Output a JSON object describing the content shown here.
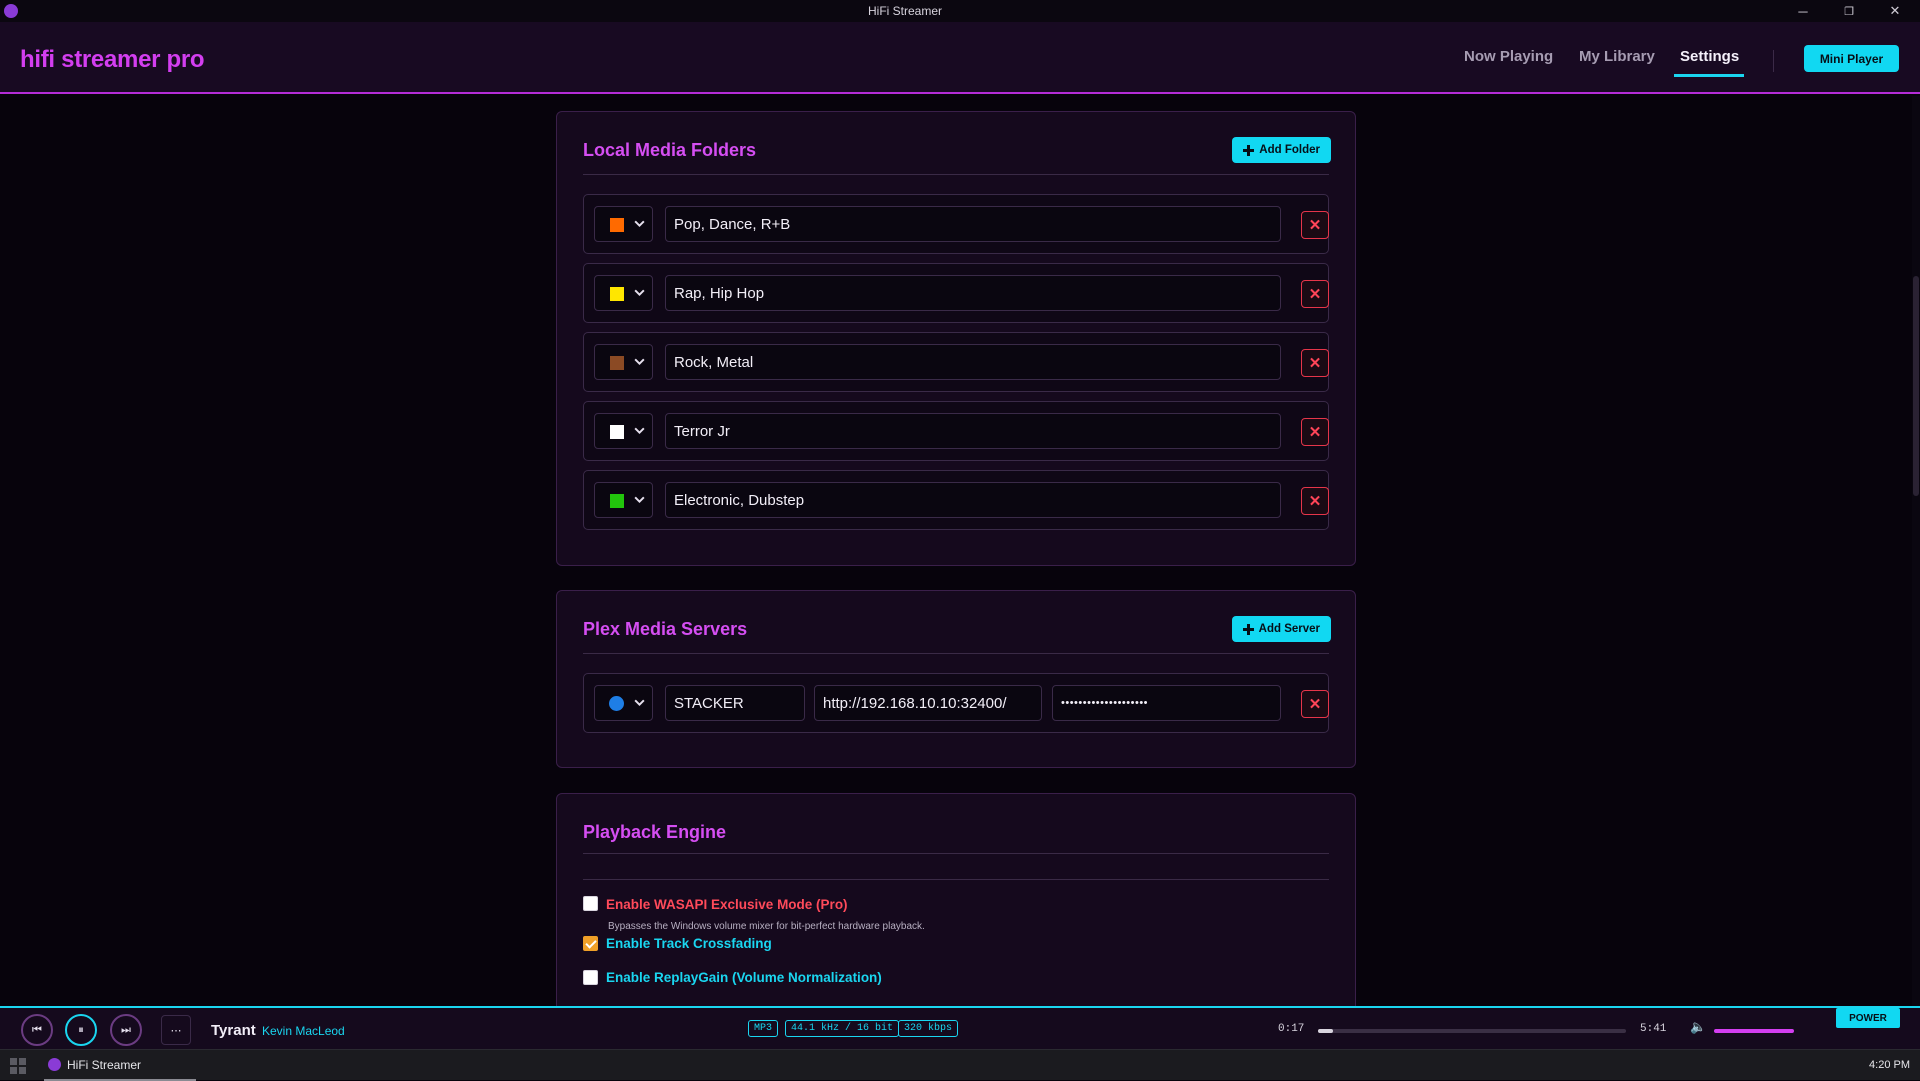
{
  "window": {
    "title": "HiFi Streamer",
    "minimize": "─",
    "restore": "❐",
    "close": "✕"
  },
  "header": {
    "brand": "hifi streamer pro",
    "nav": [
      {
        "label": "Now Playing",
        "active": false
      },
      {
        "label": "My Library",
        "active": false
      },
      {
        "label": "Settings",
        "active": true
      }
    ],
    "mini_player": "Mini Player"
  },
  "local_folders": {
    "title": "Local Media Folders",
    "add_label": "Add Folder",
    "rows": [
      {
        "color": "#ff6a00",
        "name": "Pop, Dance, R+B"
      },
      {
        "color": "#ffe600",
        "name": "Rap, Hip Hop"
      },
      {
        "color": "#8b4a24",
        "name": "Rock, Metal"
      },
      {
        "color": "#ffffff",
        "name": "Terror Jr"
      },
      {
        "color": "#22c40c",
        "name": "Electronic, Dubstep"
      }
    ]
  },
  "plex": {
    "title": "Plex Media Servers",
    "add_label": "Add Server",
    "server": {
      "color": "#1e7ee6",
      "name": "STACKER",
      "url": "http://192.168.10.10:32400/",
      "token": "••••••••••••••••••••"
    }
  },
  "playback": {
    "title": "Playback Engine",
    "options": [
      {
        "label": "Enable WASAPI Exclusive Mode (Pro)",
        "checked": false,
        "color": "#ff4a5a",
        "hint": "Bypasses the Windows volume mixer for bit-perfect hardware playback."
      },
      {
        "label": "Enable Track Crossfading",
        "checked": true,
        "color": "#1ad6f0",
        "hint": ""
      },
      {
        "label": "Enable ReplayGain (Volume Normalization)",
        "checked": false,
        "color": "#1ad6f0",
        "hint": ""
      }
    ]
  },
  "player": {
    "prev": "⏮",
    "pause": "⏸",
    "next": "⏭",
    "more": "⋯",
    "track": "Tyrant",
    "artist": "Kevin MacLeod",
    "badges": [
      "MP3",
      "44.1 kHz / 16 bit",
      "320 kbps"
    ],
    "elapsed": "0:17",
    "duration": "5:41",
    "progress_fraction": 0.05,
    "volume_icon": "🔈",
    "power": "POWER"
  },
  "taskbar": {
    "app_label": "HiFi Streamer",
    "clock": "4:20 PM"
  }
}
